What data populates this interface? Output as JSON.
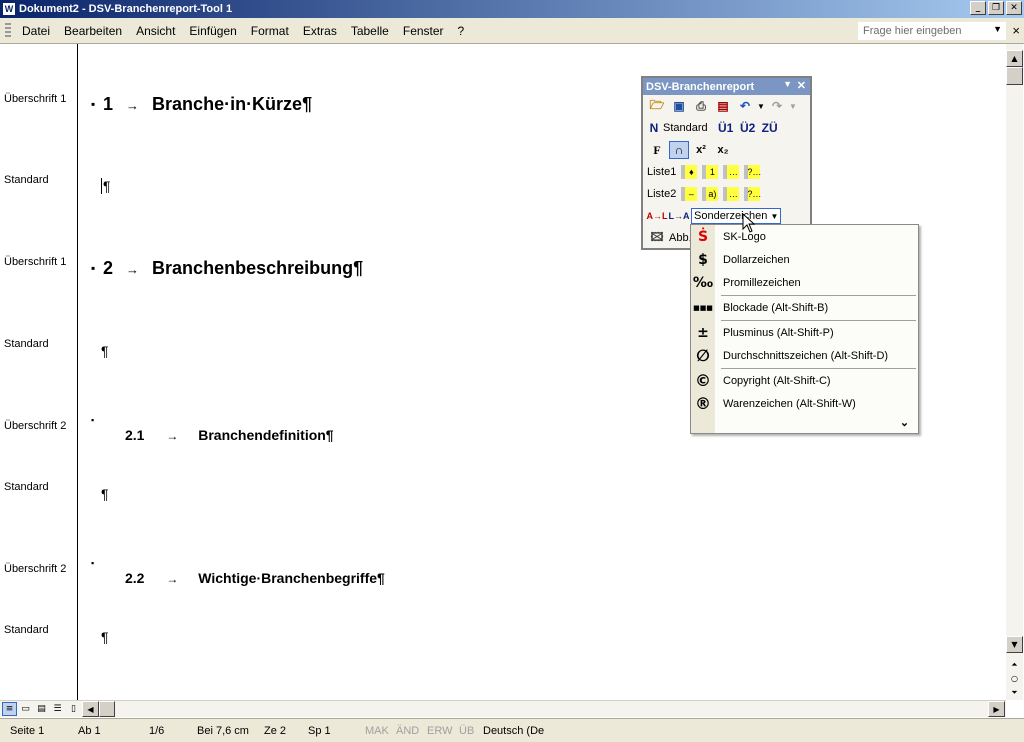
{
  "window": {
    "title": "Dokument2 - DSV-Branchenreport-Tool 1",
    "app_icon": "W"
  },
  "menu": {
    "items": [
      "Datei",
      "Bearbeiten",
      "Ansicht",
      "Einfügen",
      "Format",
      "Extras",
      "Tabelle",
      "Fenster",
      "?"
    ],
    "ask_placeholder": "Frage hier eingeben"
  },
  "styles": [
    {
      "label": "Überschrift 1"
    },
    {
      "label": "Standard"
    },
    {
      "label": "Überschrift 1"
    },
    {
      "label": "Standard"
    },
    {
      "label": "Überschrift 2"
    },
    {
      "label": "Standard"
    },
    {
      "label": "Überschrift 2"
    },
    {
      "label": "Standard"
    }
  ],
  "document": {
    "h1a_num": "1",
    "h1a_text": "Branche·in·Kürze¶",
    "h1b_num": "2",
    "h1b_text": "Branchenbeschreibung¶",
    "h2a_num": "2.1",
    "h2a_text": "Branchendefinition¶",
    "h2b_num": "2.2",
    "h2b_text": "Wichtige·Branchenbegriffe¶",
    "tab_arrow": "→",
    "pilcrow": "¶",
    "bullet": "▪"
  },
  "toolbar": {
    "title": "DSV-Branchenreport",
    "standard_label": "Standard",
    "u1": "Ü1",
    "u2": "Ü2",
    "zu": "ZÜ",
    "bold": "F",
    "liste1": "Liste1",
    "liste2": "Liste2",
    "sonder": "Sonderzeichen",
    "abb": "Abb."
  },
  "dropdown": {
    "items": [
      {
        "icon": "sk-logo-icon",
        "glyph": "Ṡ",
        "label": "SK-Logo"
      },
      {
        "icon": "dollar-icon",
        "glyph": "$",
        "label": "Dollarzeichen"
      },
      {
        "icon": "promille-icon",
        "glyph": "‰",
        "label": "Promillezeichen"
      },
      {
        "icon": "blockade-icon",
        "glyph": "■■■",
        "label": "Blockade (Alt-Shift-B)"
      },
      {
        "icon": "plusminus-icon",
        "glyph": "±",
        "label": "Plusminus (Alt-Shift-P)"
      },
      {
        "icon": "durchschnitt-icon",
        "glyph": "∅",
        "label": "Durchschnittszeichen (Alt-Shift-D)"
      },
      {
        "icon": "copyright-icon",
        "glyph": "©",
        "label": "Copyright (Alt-Shift-C)"
      },
      {
        "icon": "registered-icon",
        "glyph": "®",
        "label": "Warenzeichen (Alt-Shift-W)"
      }
    ],
    "more": "⌄"
  },
  "status": {
    "seite": "Seite 1",
    "ab": "Ab 1",
    "pages": "1/6",
    "bei": "Bei 7,6 cm",
    "ze": "Ze 2",
    "sp": "Sp 1",
    "mak": "MAK",
    "aend": "ÄND",
    "erw": "ERW",
    "ueb": "ÜB",
    "lang": "Deutsch (De"
  },
  "colors": {
    "titlebar": "#0a246a",
    "toolbar_title": "#7b96c2",
    "highlight": "#ffff40"
  }
}
